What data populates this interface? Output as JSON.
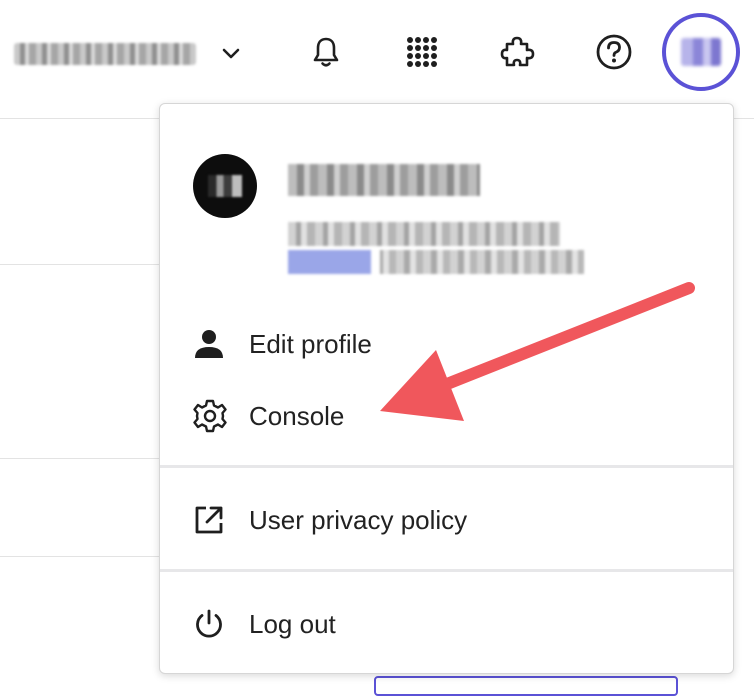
{
  "header": {
    "workspace_name": "Fiddle-Z/Dobr",
    "icons": [
      "chevron-down-icon",
      "bell-icon",
      "apps-grid-icon",
      "puzzle-icon",
      "help-icon"
    ]
  },
  "account_menu": {
    "user_name": "",
    "user_email": "",
    "items": [
      {
        "label": "Edit profile",
        "icon": "person-icon"
      },
      {
        "label": "Console",
        "icon": "gear-icon"
      },
      {
        "label": "User privacy policy",
        "icon": "external-link-icon"
      },
      {
        "label": "Log out",
        "icon": "power-icon"
      }
    ]
  },
  "colors": {
    "accent": "#5b52d6",
    "annotation_arrow": "#f0575c",
    "separator": "#e7e7e9"
  }
}
